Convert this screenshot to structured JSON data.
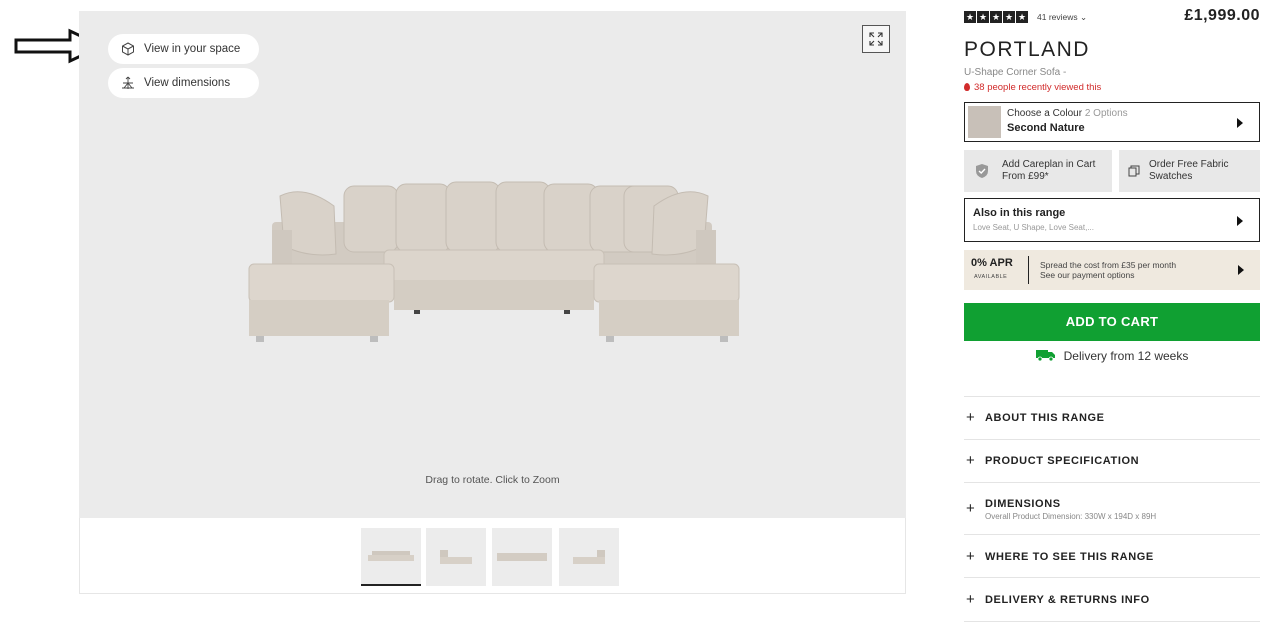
{
  "viewer": {
    "view_in_space_label": "View in your space",
    "view_dimensions_label": "View dimensions",
    "hint": "Drag to rotate. Click to Zoom"
  },
  "thumbnails": [
    {
      "view": "front",
      "active": true
    },
    {
      "view": "side",
      "active": false
    },
    {
      "view": "back",
      "active": false
    },
    {
      "view": "side-corner",
      "active": false
    }
  ],
  "product": {
    "rating_stars": 5,
    "reviews": "41 reviews",
    "price": "£1,999.00",
    "name": "PORTLAND",
    "subtitle": "U-Shape Corner Sofa -",
    "recently_viewed": "38 people recently viewed this",
    "colour": {
      "label": "Choose a Colour",
      "options": "2 Options",
      "value": "Second Nature",
      "swatch_color": "#c8c0b8"
    },
    "careplan": {
      "line1": "Add Careplan in Cart",
      "line2": "From £99*"
    },
    "fabric": {
      "line1": "Order Free Fabric",
      "line2": "Swatches"
    },
    "range": {
      "title": "Also in this range",
      "items": "Love Seat, U Shape, Love Seat,..."
    },
    "apr": {
      "big": "0% APR",
      "small": "AVAILABLE",
      "line1": "Spread the cost from £35 per month",
      "line2": "See our payment options"
    },
    "add_to_cart": "ADD TO CART",
    "delivery": "Delivery from 12 weeks"
  },
  "accordion": [
    {
      "label": "ABOUT THIS RANGE"
    },
    {
      "label": "PRODUCT SPECIFICATION"
    },
    {
      "label": "DIMENSIONS",
      "sub": "Overall Product Dimension: 330W x 194D x 89H"
    },
    {
      "label": "WHERE TO SEE THIS RANGE"
    },
    {
      "label": "DELIVERY & RETURNS INFO"
    }
  ],
  "colors": {
    "accent_green": "#10a032",
    "alert_red": "#d12b2b",
    "apr_bg": "#efe9df"
  }
}
